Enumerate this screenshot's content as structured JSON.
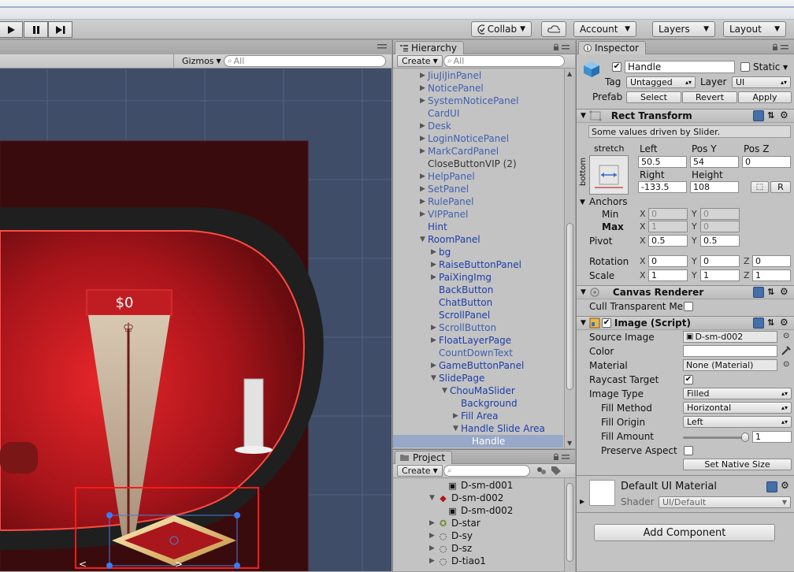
{
  "toolbar": {
    "collab": "Collab",
    "account": "Account",
    "layers": "Layers",
    "layout": "Layout"
  },
  "scene": {
    "gizmos": "Gizmos",
    "search_placeholder": "All",
    "price_label": "$0"
  },
  "hierarchy": {
    "tab": "Hierarchy",
    "create": "Create",
    "search_placeholder": "All",
    "items": [
      {
        "label": "JiuJiJinPanel",
        "indent": 0,
        "arrow": "▶",
        "color": "fblue"
      },
      {
        "label": "NoticePanel",
        "indent": 0,
        "arrow": "▶",
        "color": "fblue"
      },
      {
        "label": "SystemNoticePanel",
        "indent": 0,
        "arrow": "▶",
        "color": "fblue"
      },
      {
        "label": "CardUI",
        "indent": 0,
        "arrow": "",
        "color": "fblue"
      },
      {
        "label": "Desk",
        "indent": 0,
        "arrow": "▶",
        "color": "fblue"
      },
      {
        "label": "LoginNoticePanel",
        "indent": 0,
        "arrow": "▶",
        "color": "fblue"
      },
      {
        "label": "MarkCardPanel",
        "indent": 0,
        "arrow": "▶",
        "color": "fblue"
      },
      {
        "label": "CloseButtonVIP (2)",
        "indent": 0,
        "arrow": "",
        "color": "gray"
      },
      {
        "label": "HelpPanel",
        "indent": 0,
        "arrow": "▶",
        "color": "fblue"
      },
      {
        "label": "SetPanel",
        "indent": 0,
        "arrow": "▶",
        "color": "fblue"
      },
      {
        "label": "RulePanel",
        "indent": 0,
        "arrow": "▶",
        "color": "fblue"
      },
      {
        "label": "VIPPanel",
        "indent": 0,
        "arrow": "▶",
        "color": "fblue"
      },
      {
        "label": "Hint",
        "indent": 0,
        "arrow": "",
        "color": "blue"
      },
      {
        "label": "RoomPanel",
        "indent": 0,
        "arrow": "▼",
        "color": "blue"
      },
      {
        "label": "bg",
        "indent": 1,
        "arrow": "▶",
        "color": "blue"
      },
      {
        "label": "RaiseButtonPanel",
        "indent": 1,
        "arrow": "▶",
        "color": "blue"
      },
      {
        "label": "PaiXingImg",
        "indent": 1,
        "arrow": "▶",
        "color": "blue"
      },
      {
        "label": "BackButton",
        "indent": 1,
        "arrow": "",
        "color": "blue"
      },
      {
        "label": "ChatButton",
        "indent": 1,
        "arrow": "",
        "color": "blue"
      },
      {
        "label": "ScrollPanel",
        "indent": 1,
        "arrow": "",
        "color": "blue"
      },
      {
        "label": "ScrollButton",
        "indent": 1,
        "arrow": "▶",
        "color": "fblue"
      },
      {
        "label": "FloatLayerPage",
        "indent": 1,
        "arrow": "▶",
        "color": "blue"
      },
      {
        "label": "CountDownText",
        "indent": 1,
        "arrow": "",
        "color": "fblue"
      },
      {
        "label": "GameButtonPanel",
        "indent": 1,
        "arrow": "▶",
        "color": "blue"
      },
      {
        "label": "SlidePage",
        "indent": 1,
        "arrow": "▼",
        "color": "blue"
      },
      {
        "label": "ChouMaSlider",
        "indent": 2,
        "arrow": "▼",
        "color": "blue"
      },
      {
        "label": "Background",
        "indent": 3,
        "arrow": "",
        "color": "blue"
      },
      {
        "label": "Fill Area",
        "indent": 3,
        "arrow": "▶",
        "color": "blue"
      },
      {
        "label": "Handle Slide Area",
        "indent": 3,
        "arrow": "▼",
        "color": "blue"
      },
      {
        "label": "Handle",
        "indent": 4,
        "arrow": "",
        "color": "sel"
      }
    ]
  },
  "project": {
    "tab": "Project",
    "create": "Create",
    "items": [
      {
        "label": "D-sm-d001",
        "indent": 1,
        "arrow": "",
        "icon": "image-asset-icon"
      },
      {
        "label": "D-sm-d002",
        "indent": 0,
        "arrow": "▼",
        "icon": "sprite-diamond-icon"
      },
      {
        "label": "D-sm-d002",
        "indent": 1,
        "arrow": "",
        "icon": "image-asset-icon"
      },
      {
        "label": "D-star",
        "indent": 0,
        "arrow": "▶",
        "icon": "star-sprite-icon"
      },
      {
        "label": "D-sy",
        "indent": 0,
        "arrow": "▶",
        "icon": "sprite-icon"
      },
      {
        "label": "D-sz",
        "indent": 0,
        "arrow": "▶",
        "icon": "sprite-icon"
      },
      {
        "label": "D-tiao1",
        "indent": 0,
        "arrow": "▶",
        "icon": "sprite-icon"
      }
    ]
  },
  "inspector": {
    "tab": "Inspector",
    "object_name": "Handle",
    "static_label": "Static",
    "tag_label": "Tag",
    "tag_value": "Untagged",
    "layer_label": "Layer",
    "layer_value": "UI",
    "prefab_label": "Prefab",
    "prefab_select": "Select",
    "prefab_revert": "Revert",
    "prefab_apply": "Apply",
    "rect": {
      "title": "Rect Transform",
      "info": "Some values driven by Slider.",
      "anchor_h": "stretch",
      "anchor_v": "bottom",
      "left_label": "Left",
      "left": "50.5",
      "posy_label": "Pos Y",
      "posy": "54",
      "posz_label": "Pos Z",
      "posz": "0",
      "right_label": "Right",
      "right": "-133.5",
      "height_label": "Height",
      "height": "108",
      "r_button": "R",
      "anchors_label": "Anchors",
      "min_label": "Min",
      "max_label": "Max",
      "min_x": "0",
      "min_y": "0",
      "max_x": "1",
      "max_y": "0",
      "pivot_label": "Pivot",
      "pivot_x": "0.5",
      "pivot_y": "0.5",
      "rotation_label": "Rotation",
      "rot_x": "0",
      "rot_y": "0",
      "rot_z": "0",
      "scale_label": "Scale",
      "scale_x": "1",
      "scale_y": "1",
      "scale_z": "1"
    },
    "canvas_renderer": {
      "title": "Canvas Renderer",
      "cull_label": "Cull Transparent Me:"
    },
    "image": {
      "title": "Image (Script)",
      "source_label": "Source Image",
      "source_value": "D-sm-d002",
      "color_label": "Color",
      "material_label": "Material",
      "material_value": "None (Material)",
      "raycast_label": "Raycast Target",
      "type_label": "Image Type",
      "type_value": "Filled",
      "fill_method_label": "Fill Method",
      "fill_method_value": "Horizontal",
      "fill_origin_label": "Fill Origin",
      "fill_origin_value": "Left",
      "fill_amount_label": "Fill Amount",
      "fill_amount_value": "1",
      "preserve_label": "Preserve Aspect",
      "native_size": "Set Native Size"
    },
    "material": {
      "title": "Default UI Material",
      "shader_label": "Shader",
      "shader_value": "UI/Default"
    },
    "add_component": "Add Component"
  },
  "axis": {
    "x": "X",
    "y": "Y",
    "z": "Z"
  }
}
